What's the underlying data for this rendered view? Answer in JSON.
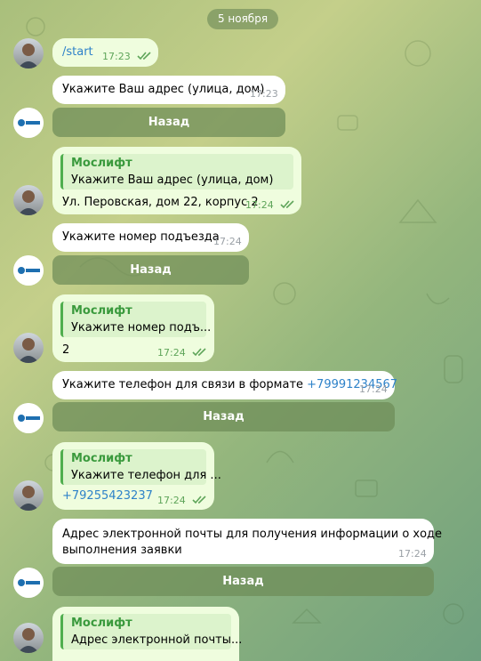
{
  "chat": {
    "date_label": "5 ноября",
    "bot_name": "Мослифт",
    "messages": {
      "m1": {
        "text": "/start",
        "time": "17:23"
      },
      "m2": {
        "text": "Укажите Ваш адрес (улица, дом)",
        "time": "17:23",
        "button": "Назад"
      },
      "m3": {
        "quote_name": "Мослифт",
        "quote_text": "Укажите Ваш адрес (улица, дом)",
        "text": "Ул. Перовская, дом 22, корпус 2",
        "time": "17:24"
      },
      "m4": {
        "text": "Укажите номер подъезда",
        "time": "17:24",
        "button": "Назад"
      },
      "m5": {
        "quote_name": "Мослифт",
        "quote_text": "Укажите номер подъ...",
        "text": "2",
        "time": "17:24"
      },
      "m6": {
        "text": "Укажите телефон для связи в формате ",
        "link": "+79991234567",
        "time": "17:24",
        "button": "Назад"
      },
      "m7": {
        "quote_name": "Мослифт",
        "quote_text": "Укажите телефон для ...",
        "text": "+79255423237",
        "time": "17:24"
      },
      "m8": {
        "text_line1": "Адрес электронной почты для получения информации о ходе",
        "text_line2": "выполнения заявки",
        "time": "17:24",
        "button": "Назад"
      },
      "m9": {
        "quote_name": "Мослифт",
        "quote_text": "Адрес электронной почты..."
      }
    }
  },
  "colors": {
    "outgoing_bubble": "#effdde",
    "incoming_bubble": "#ffffff",
    "accent_green": "#4fae4e",
    "link_blue": "#2e82c9"
  },
  "icons": {
    "read_receipt": "double-check-icon",
    "bot_avatar": "moslift-logo-icon",
    "user_avatar": "user-photo"
  }
}
